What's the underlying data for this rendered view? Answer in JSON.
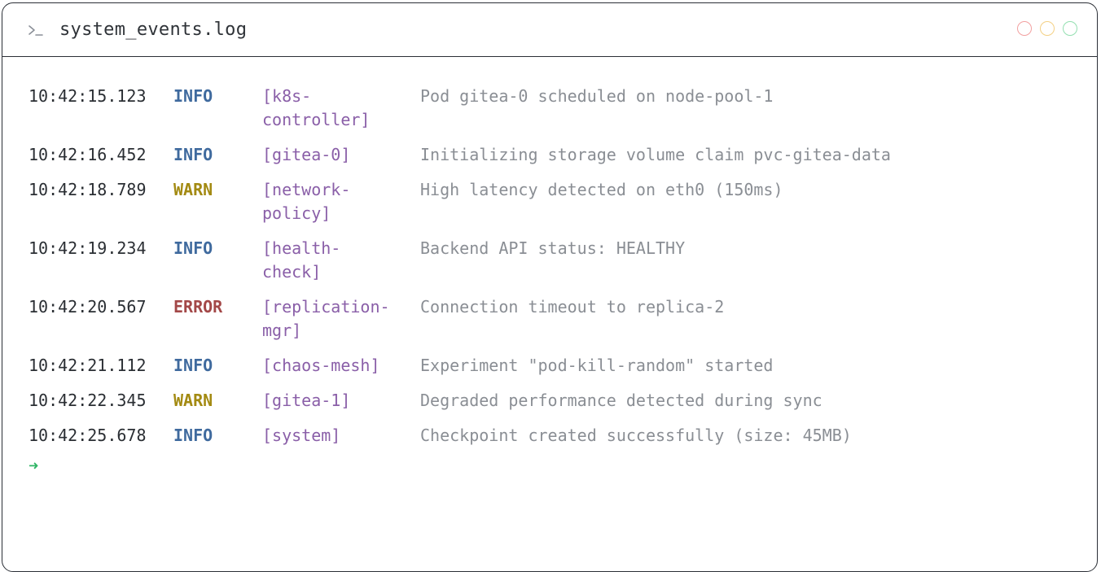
{
  "window": {
    "title": "system_events.log",
    "prompt_icon": "terminal-prompt-icon",
    "controls": [
      "close-icon",
      "minimize-icon",
      "maximize-icon"
    ]
  },
  "colors": {
    "info": "#3f6a9e",
    "warn": "#a38a12",
    "error": "#a34848",
    "source": "#8a5fa8",
    "message": "#8a8e94",
    "cursor": "#2fb565"
  },
  "log": {
    "rows": [
      {
        "time": "10:42:15.123",
        "level": "INFO",
        "source": "[k8s-\ncontroller]",
        "message": "Pod gitea-0 scheduled on node-pool-1"
      },
      {
        "time": "10:42:16.452",
        "level": "INFO",
        "source": "[gitea-0]",
        "message": "Initializing storage volume claim pvc-gitea-data"
      },
      {
        "time": "10:42:18.789",
        "level": "WARN",
        "source": "[network-\npolicy]",
        "message": "High latency detected on eth0 (150ms)"
      },
      {
        "time": "10:42:19.234",
        "level": "INFO",
        "source": "[health-\ncheck]",
        "message": "Backend API status: HEALTHY"
      },
      {
        "time": "10:42:20.567",
        "level": "ERROR",
        "source": "[replication-\nmgr]",
        "message": "Connection timeout to replica-2"
      },
      {
        "time": "10:42:21.112",
        "level": "INFO",
        "source": "[chaos-mesh]",
        "message": "Experiment \"pod-kill-random\" started"
      },
      {
        "time": "10:42:22.345",
        "level": "WARN",
        "source": "[gitea-1]",
        "message": "Degraded performance detected during sync"
      },
      {
        "time": "10:42:25.678",
        "level": "INFO",
        "source": "[system]",
        "message": "Checkpoint created successfully (size: 45MB)"
      }
    ],
    "cursor": "➜"
  }
}
